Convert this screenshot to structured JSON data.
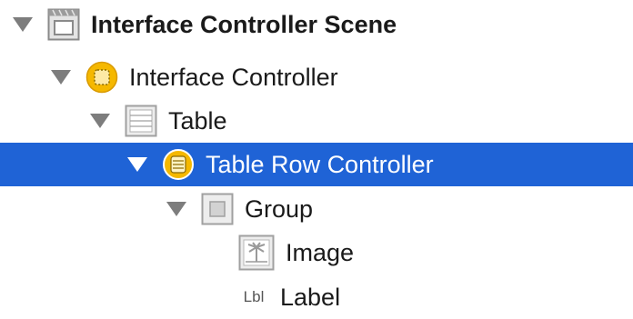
{
  "outline": {
    "scene": {
      "label": "Interface Controller Scene",
      "icon": "storyboard-scene-icon"
    },
    "controller": {
      "label": "Interface Controller",
      "icon": "interface-controller-icon"
    },
    "table": {
      "label": "Table",
      "icon": "table-icon"
    },
    "row_controller": {
      "label": "Table Row Controller",
      "icon": "row-controller-icon"
    },
    "group": {
      "label": "Group",
      "icon": "group-icon"
    },
    "image": {
      "label": "Image",
      "icon": "image-icon"
    },
    "label_item": {
      "label": "Label",
      "icon_text": "Lbl"
    }
  },
  "colors": {
    "selection": "#1f63d6",
    "controller_yellow": "#f5b800",
    "disclosure": "#7d7d7d"
  }
}
